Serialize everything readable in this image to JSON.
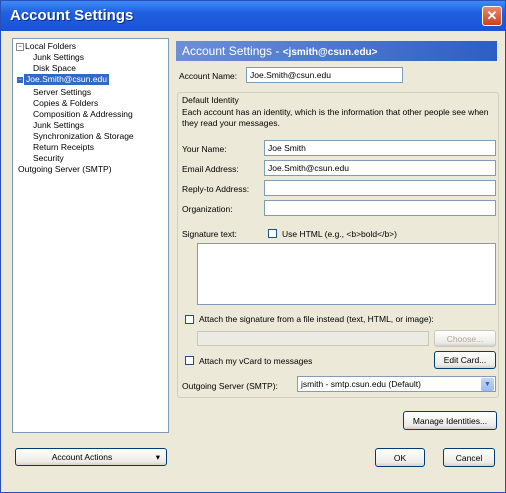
{
  "window": {
    "title": "Account Settings",
    "close_glyph": "✕"
  },
  "tree": {
    "items": [
      {
        "label": "Local Folders",
        "expander": "−"
      },
      {
        "label": "Junk Settings"
      },
      {
        "label": "Disk Space"
      },
      {
        "label": "Joe.Smith@csun.edu",
        "expander": "−"
      },
      {
        "label": "Server Settings"
      },
      {
        "label": "Copies & Folders"
      },
      {
        "label": "Composition & Addressing"
      },
      {
        "label": "Junk Settings"
      },
      {
        "label": "Synchronization & Storage"
      },
      {
        "label": "Return Receipts"
      },
      {
        "label": "Security"
      },
      {
        "label": "Outgoing Server (SMTP)"
      }
    ]
  },
  "account_actions": {
    "label": "Account Actions",
    "arrow": "▾"
  },
  "header": {
    "prefix": "Account Settings - ",
    "email": "<jsmith@csun.edu>"
  },
  "form": {
    "account_name_label": "Account Name:",
    "account_name_value": "Joe.Smith@csun.edu",
    "identity_legend": "Default Identity",
    "identity_desc": "Each account has an identity, which is the information that other people see when they read your messages.",
    "your_name_label": "Your Name:",
    "your_name_value": "Joe Smith",
    "email_label": "Email Address:",
    "email_value": "Joe.Smith@csun.edu",
    "reply_label": "Reply-to Address:",
    "reply_value": "",
    "org_label": "Organization:",
    "org_value": "",
    "signature_label": "Signature text:",
    "use_html_label": "Use HTML (e.g., <b>bold</b>)",
    "attach_sig_label": "Attach the signature from a file instead (text, HTML, or image):",
    "choose_label": "Choose...",
    "vcard_label": "Attach my vCard to messages",
    "edit_card_label": "Edit Card...",
    "smtp_label": "Outgoing Server (SMTP):",
    "smtp_value": "jsmith - smtp.csun.edu (Default)",
    "manage_label": "Manage Identities..."
  },
  "footer": {
    "ok": "OK",
    "cancel": "Cancel"
  }
}
